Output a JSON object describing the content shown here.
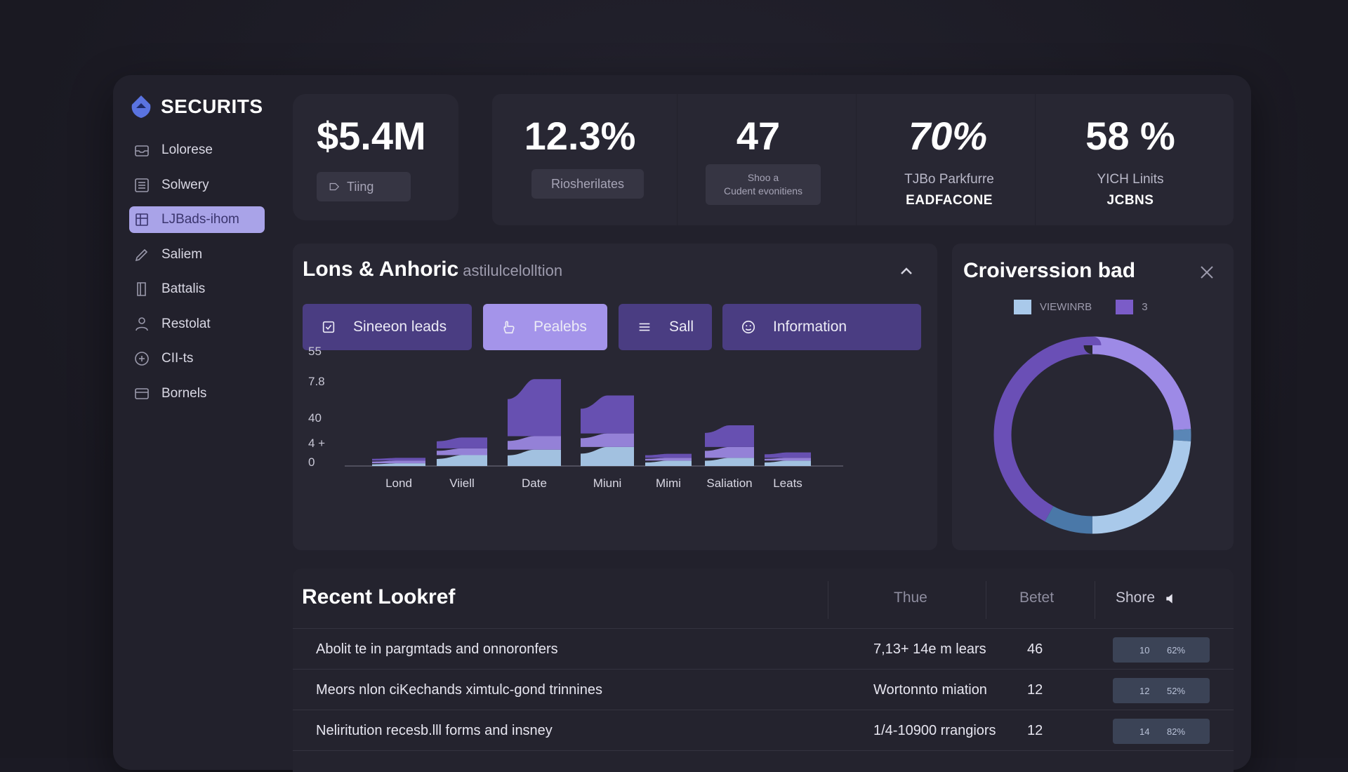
{
  "brand": {
    "name": "SECURITS"
  },
  "sidebar": {
    "items": [
      {
        "label": "Lolorese",
        "icon": "inbox-icon",
        "active": false
      },
      {
        "label": "Solwery",
        "icon": "list-icon",
        "active": false
      },
      {
        "label": "LJBads-ihom",
        "icon": "grid-icon",
        "active": true
      },
      {
        "label": "Saliem",
        "icon": "pen-icon",
        "active": false
      },
      {
        "label": "Battalis",
        "icon": "book-icon",
        "active": false
      },
      {
        "label": "Restolat",
        "icon": "user-icon",
        "active": false
      },
      {
        "label": "CII-ts",
        "icon": "circle-plus-icon",
        "active": false
      },
      {
        "label": "Bornels",
        "icon": "card-icon",
        "active": false
      }
    ]
  },
  "kpis": {
    "main": {
      "value": "$5.4M",
      "pill": "Tiing"
    },
    "group": [
      {
        "value": "12.3%",
        "pill": "Riosherilates"
      },
      {
        "value": "47",
        "pill_line1": "Shoo a",
        "pill_line2": "Cudent evonitiens"
      },
      {
        "value": "70%",
        "sub1": "TJBo Parkfurre",
        "sub2": "EADFACONE"
      },
      {
        "value": "58 %",
        "sub1": "YICH Linits",
        "sub2": "JCBNS"
      }
    ]
  },
  "chart_panel": {
    "title": "Lons & Anhoric",
    "subtitle": "astilulcelolltion",
    "tabs": [
      {
        "label": "Sineeon leads",
        "icon": "check-square-icon",
        "active": false
      },
      {
        "label": "Pealebs",
        "icon": "hand-icon",
        "active": true
      },
      {
        "label": "Sall",
        "icon": "menu-icon",
        "active": false
      },
      {
        "label": "Information",
        "icon": "smile-icon",
        "active": false
      }
    ]
  },
  "chart_data": {
    "type": "area",
    "stacked": true,
    "categories": [
      "Lond",
      "Viiell",
      "Date",
      "Miuni",
      "Mimi",
      "Saliation",
      "Leats"
    ],
    "y_tick_labels": [
      "55",
      "7.8",
      "40",
      "4 +",
      "0"
    ],
    "series": [
      {
        "values": [
          2,
          8,
          12,
          14,
          4,
          6,
          4
        ]
      },
      {
        "values": [
          2,
          5,
          10,
          10,
          2,
          8,
          2
        ]
      },
      {
        "values": [
          2,
          8,
          42,
          28,
          3,
          16,
          4
        ]
      }
    ],
    "colors": [
      "#a9c9ea",
      "#9a86e0",
      "#6a52b8"
    ],
    "grid": false,
    "legend": "none"
  },
  "donut_panel": {
    "title": "Croiverssion bad",
    "legend": [
      {
        "label": "VIEWINRB",
        "color": "#a9c9ea"
      },
      {
        "label": "3",
        "color": "#7b5cc8"
      }
    ]
  },
  "donut_data": {
    "type": "pie",
    "segments": [
      {
        "value": 24,
        "color": "#9d8ae6"
      },
      {
        "value": 2,
        "color": "#5a86b6"
      },
      {
        "value": 24,
        "color": "#a9c9ea"
      },
      {
        "value": 8,
        "color": "#4a78a8"
      },
      {
        "value": 42,
        "color": "#6a4fb6"
      }
    ]
  },
  "table": {
    "title": "Recent Lookref",
    "columns": [
      "Thue",
      "Betet",
      "Shore"
    ],
    "rows": [
      {
        "desc": "Abolit te in pargmtads and onnoronfers",
        "time": "7,13+ 14e m lears",
        "num": "46",
        "chip_a": "10",
        "chip_b": "62%"
      },
      {
        "desc": "Meors nlon ciKechands ximtulc-gond trinnines",
        "time": "Wortonnto miation",
        "num": "12",
        "chip_a": "12",
        "chip_b": "52%"
      },
      {
        "desc": "Neliritution recesb.lll forms and insney",
        "time": "1/4-10900 rrangiors",
        "num": "12",
        "chip_a": "14",
        "chip_b": "82%"
      }
    ]
  }
}
